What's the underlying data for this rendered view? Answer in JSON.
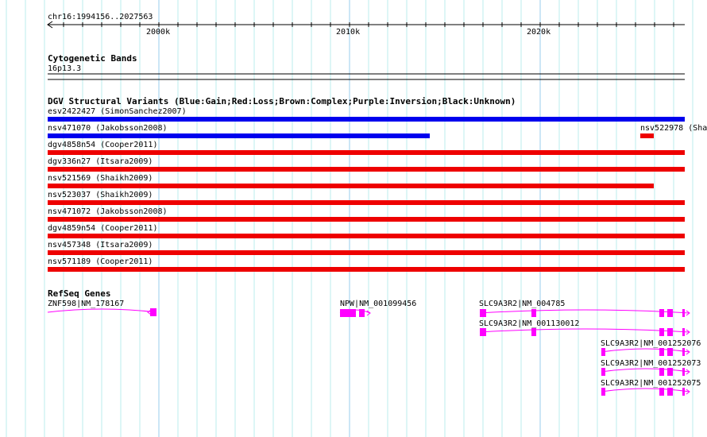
{
  "ruler": {
    "position": "chr16:1994156..2027563",
    "ticks": [
      "2000k",
      "2010k",
      "2020k"
    ]
  },
  "cyto": {
    "title": "Cytogenetic Bands",
    "band": "16p13.3"
  },
  "dgv": {
    "title": "DGV Structural Variants (Blue:Gain;Red:Loss;Brown:Complex;Purple:Inversion;Black:Unknown)",
    "rows": [
      {
        "label": "esv2422427 (SimonSanchez2007)",
        "color": "#0000ee",
        "type": "Gain"
      },
      {
        "label": "nsv471070 (Jakobsson2008)",
        "color": "#0000ee",
        "type": "Gain",
        "extra": "nsv522978 (Sha"
      },
      {
        "label": "dgv4858n54 (Cooper2011)",
        "color": "#ee0000",
        "type": "Loss"
      },
      {
        "label": "dgv336n27 (Itsara2009)",
        "color": "#ee0000",
        "type": "Loss"
      },
      {
        "label": "nsv521569 (Shaikh2009)",
        "color": "#ee0000",
        "type": "Loss"
      },
      {
        "label": "nsv523037 (Shaikh2009)",
        "color": "#ee0000",
        "type": "Loss"
      },
      {
        "label": "nsv471072 (Jakobsson2008)",
        "color": "#ee0000",
        "type": "Loss"
      },
      {
        "label": "dgv4859n54 (Cooper2011)",
        "color": "#ee0000",
        "type": "Loss"
      },
      {
        "label": "nsv457348 (Itsara2009)",
        "color": "#ee0000",
        "type": "Loss"
      },
      {
        "label": "nsv571189 (Cooper2011)",
        "color": "#ee0000",
        "type": "Loss"
      }
    ]
  },
  "refseq": {
    "title": "RefSeq Genes",
    "color": "#ff00ff",
    "genes": [
      "ZNF598|NM_178167",
      "NPW|NM_001099456",
      "SLC9A3R2|NM_004785",
      "SLC9A3R2|NM_001130012",
      "SLC9A3R2|NM_001252076",
      "SLC9A3R2|NM_001252073",
      "SLC9A3R2|NM_001252075"
    ]
  }
}
